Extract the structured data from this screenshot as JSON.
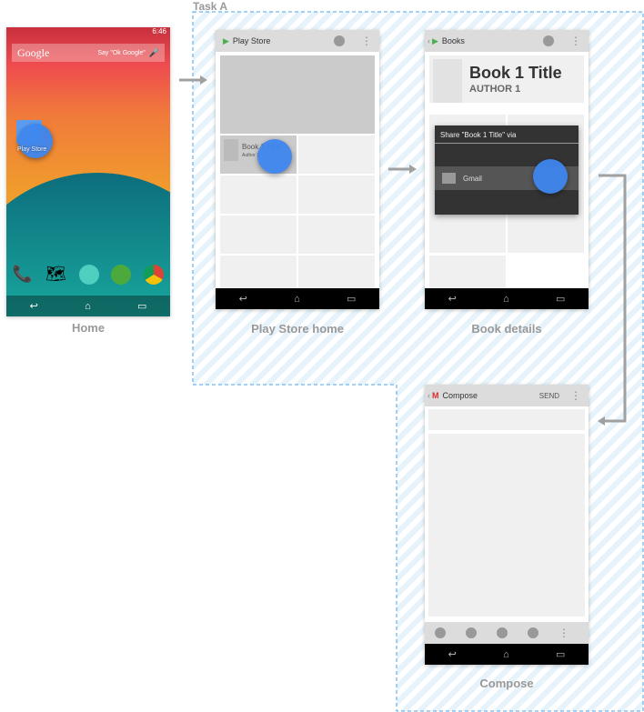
{
  "task_label": "Task A",
  "colors": {
    "touch": "#3f86ee",
    "region_border": "#4aa3e8",
    "arrow": "#a0a0a0"
  },
  "home": {
    "caption": "Home",
    "status_time": "6:46",
    "search_logo": "Google",
    "search_hint": "Say \"Ok Google\"",
    "app_label": "Play Store",
    "dock_icons": [
      "phone-icon",
      "maps-icon",
      "apps-icon",
      "hangouts-icon",
      "chrome-icon"
    ]
  },
  "play_store": {
    "caption": "Play Store home",
    "title": "Play Store",
    "item_title": "Book 1 Title",
    "item_author": "Author 1"
  },
  "book_details": {
    "caption": "Book details",
    "title": "Books",
    "book_title": "Book 1 Title",
    "book_author": "AUTHOR 1",
    "share_title": "Share \"Book 1 Title\" via",
    "share_option": "Gmail"
  },
  "compose": {
    "caption": "Compose",
    "title": "Compose",
    "send_label": "SEND"
  },
  "nav": {
    "back": "↩",
    "home": "⌂",
    "recents": "▭"
  }
}
